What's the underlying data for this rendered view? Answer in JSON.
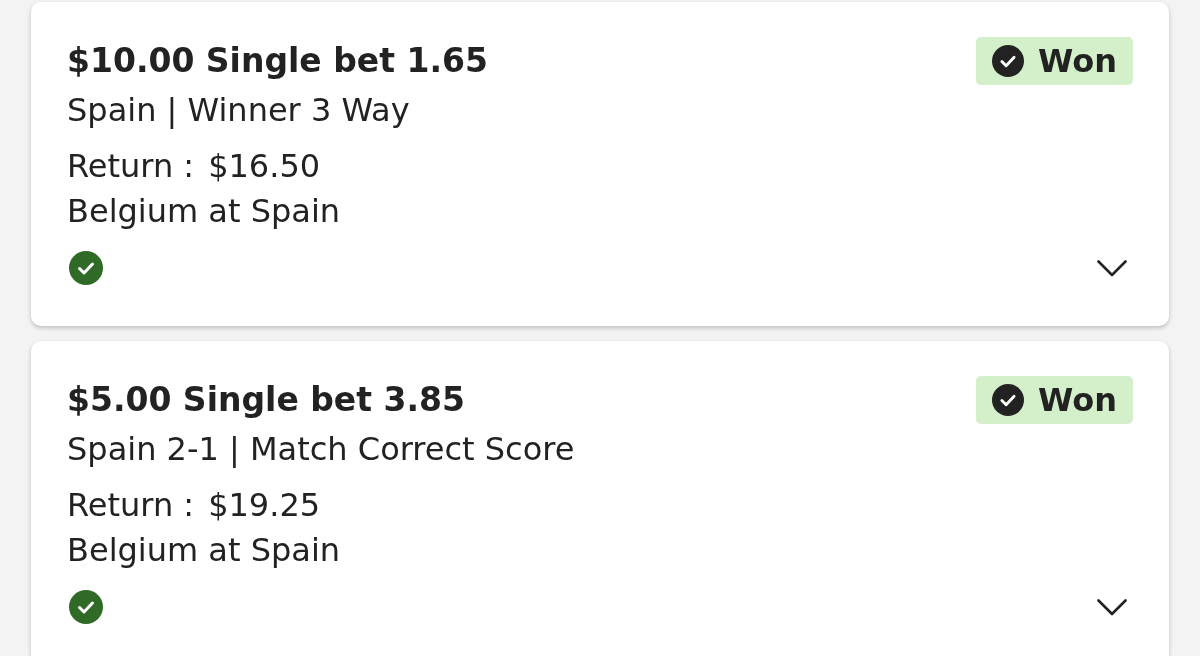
{
  "bets": [
    {
      "title": "$10.00 Single bet 1.65",
      "selection": "Spain | Winner 3 Way",
      "status": {
        "kind": "won",
        "label": "Won"
      },
      "return_label": "Return :",
      "return_value": "$16.50",
      "event": "Belgium at Spain",
      "leg_won": true,
      "expanded": false
    },
    {
      "title": "$5.00 Single bet 3.85",
      "selection": "Spain 2-1 | Match Correct Score",
      "status": {
        "kind": "won",
        "label": "Won"
      },
      "return_label": "Return :",
      "return_value": "$19.25",
      "event": "Belgium at Spain",
      "leg_won": true,
      "expanded": false
    }
  ]
}
